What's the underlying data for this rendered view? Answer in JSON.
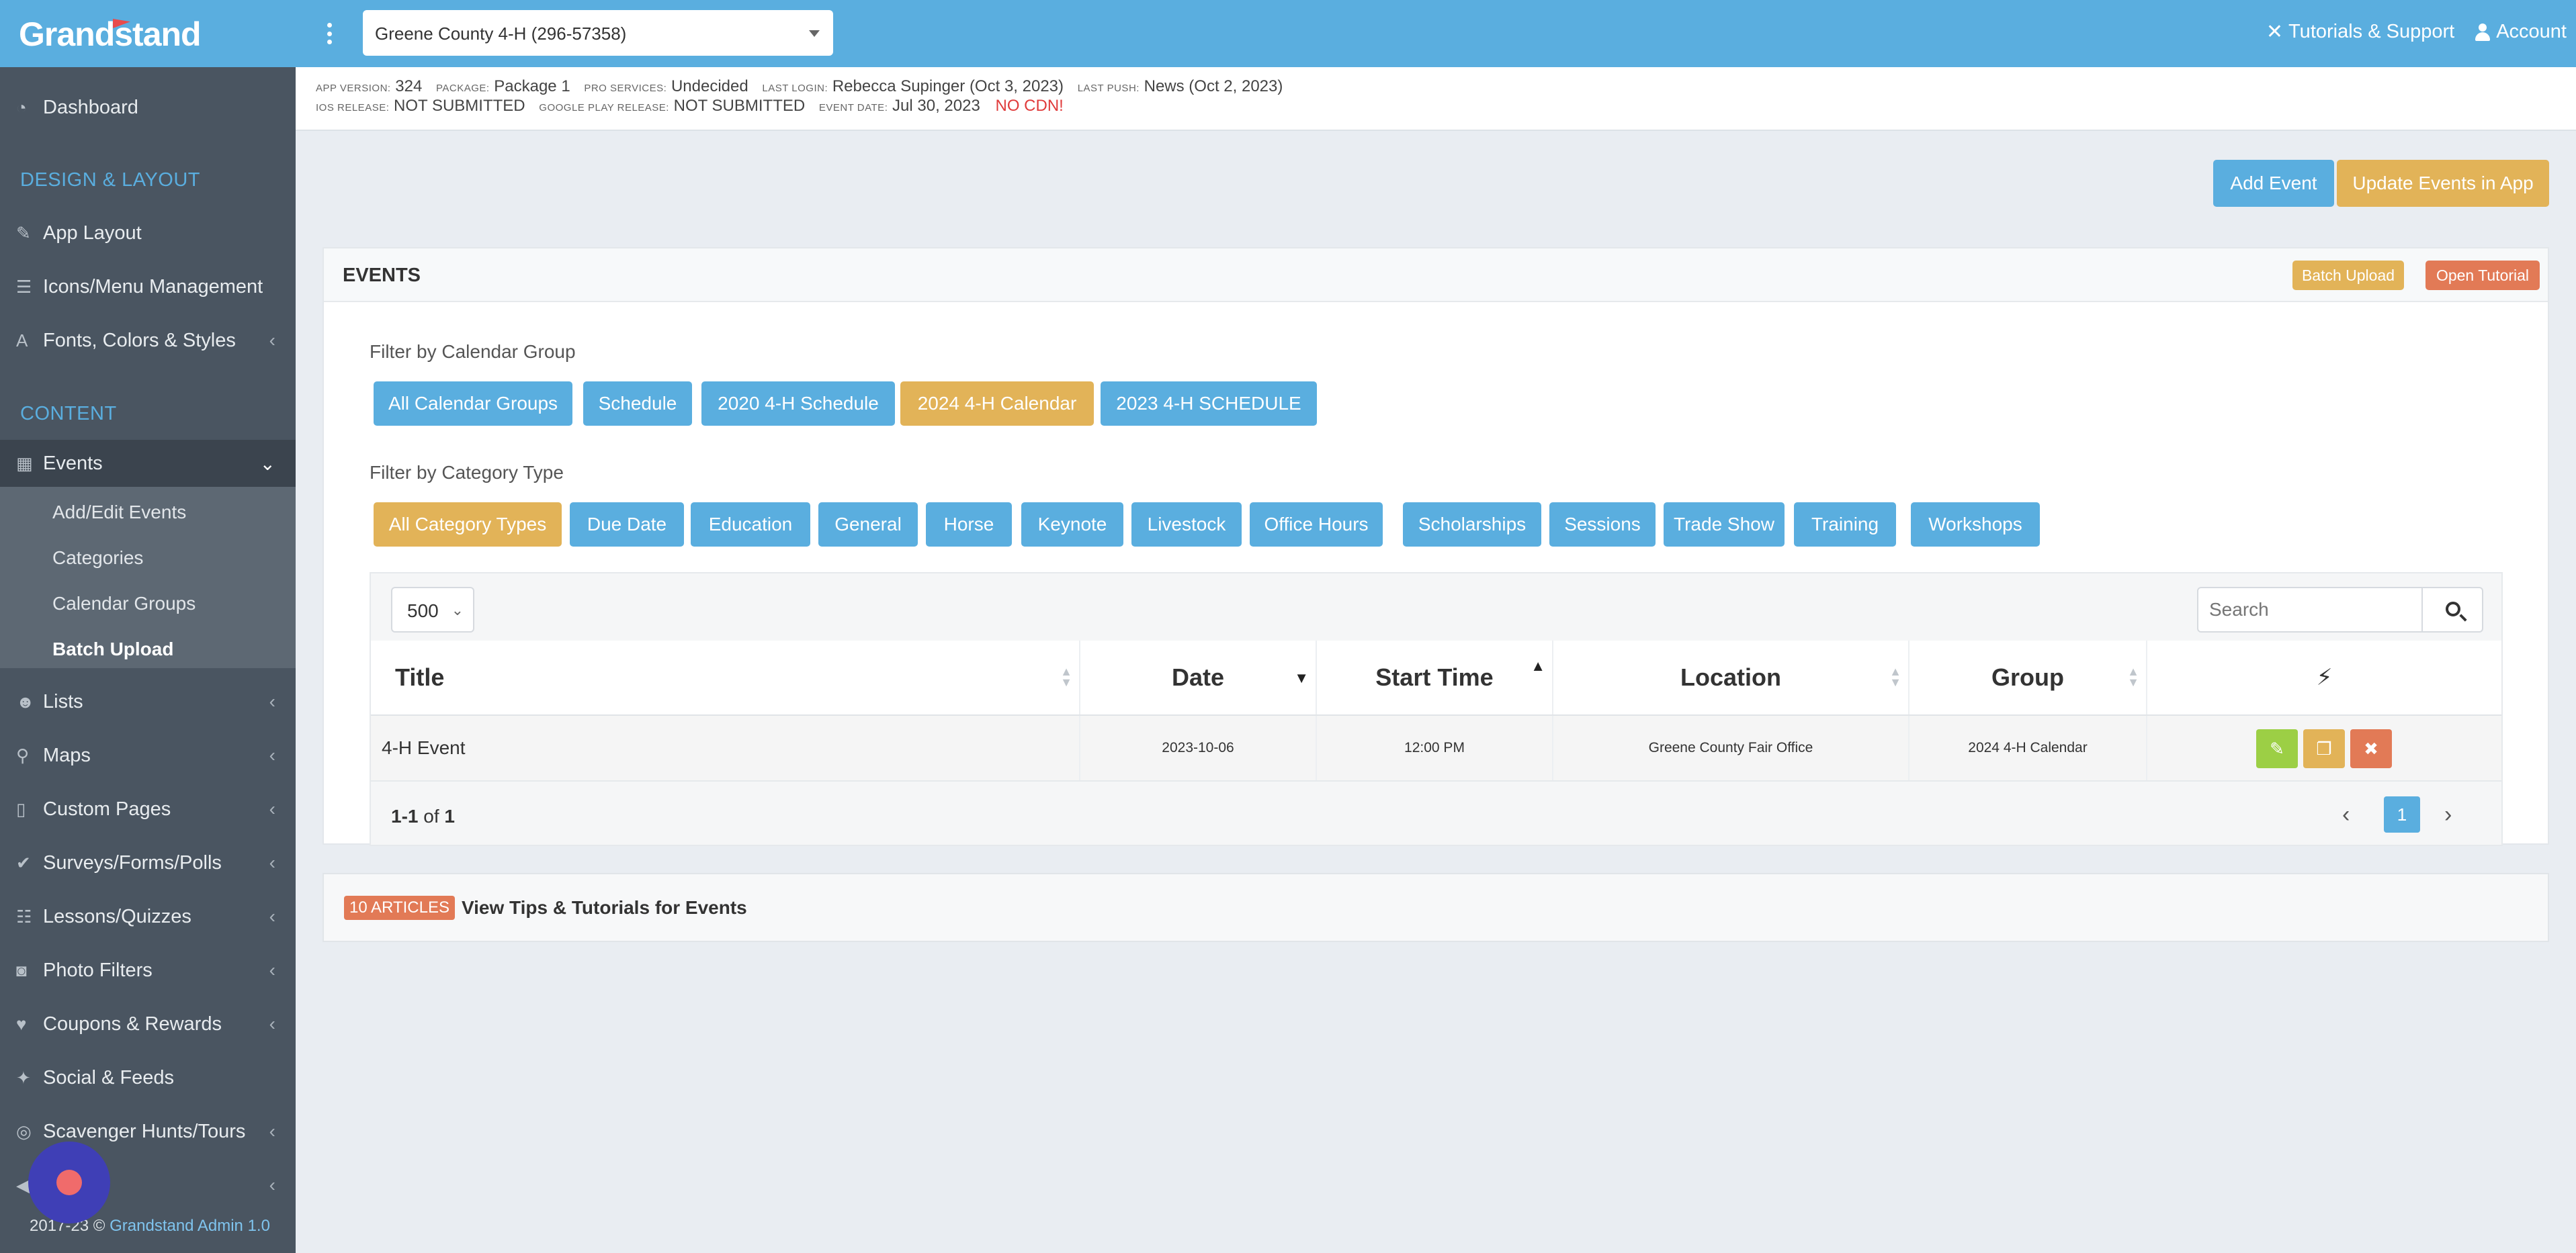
{
  "header": {
    "logo": "Grandstand",
    "app_selector": "Greene County 4-H (296-57358)",
    "tutorials": "Tutorials & Support",
    "account": "Account"
  },
  "info": {
    "app_version_label": "App Version:",
    "app_version": "324",
    "package_label": "Package:",
    "package": "Package 1",
    "pro_label": "Pro Services:",
    "pro": "Undecided",
    "last_login_label": "Last Login:",
    "last_login": "Rebecca Supinger (Oct 3, 2023)",
    "last_push_label": "Last Push:",
    "last_push": "News (Oct 2, 2023)",
    "ios_label": "iOS Release:",
    "ios": "NOT SUBMITTED",
    "gplay_label": "Google Play Release:",
    "gplay": "NOT SUBMITTED",
    "event_date_label": "Event Date:",
    "event_date": "Jul 30, 2023",
    "no_cdn": "NO CDN!"
  },
  "sidebar": {
    "dashboard": "Dashboard",
    "design_head": "DESIGN & LAYOUT",
    "app_layout": "App Layout",
    "icons_menu": "Icons/Menu Management",
    "fonts": "Fonts, Colors & Styles",
    "content_head": "CONTENT",
    "events": "Events",
    "sub": [
      "Add/Edit Events",
      "Categories",
      "Calendar Groups",
      "Batch Upload"
    ],
    "lists": "Lists",
    "maps": "Maps",
    "custom_pages": "Custom Pages",
    "surveys": "Surveys/Forms/Polls",
    "lessons": "Lessons/Quizzes",
    "photo_filters": "Photo Filters",
    "coupons": "Coupons & Rewards",
    "social": "Social & Feeds",
    "scavenger": "Scavenger Hunts/Tours",
    "footer_prefix": "2017-23 © ",
    "footer_link": "Grandstand Admin 1.0"
  },
  "actions": {
    "add_event": "Add Event",
    "update_events": "Update Events in App",
    "batch_upload": "Batch Upload",
    "open_tutorial": "Open Tutorial"
  },
  "panel": {
    "title": "EVENTS",
    "filter_group_label": "Filter by Calendar Group",
    "calendar_groups": [
      "All Calendar Groups",
      "Schedule",
      "2020 4-H Schedule",
      "2024 4-H Calendar",
      "2023 4-H SCHEDULE"
    ],
    "filter_category_label": "Filter by Category Type",
    "categories": [
      "All Category Types",
      "Due Date",
      "Education",
      "General",
      "Horse",
      "Keynote",
      "Livestock",
      "Office Hours",
      "Scholarships",
      "Sessions",
      "Trade Show",
      "Training",
      "Workshops"
    ]
  },
  "table": {
    "page_length": "500",
    "search_placeholder": "Search",
    "columns": [
      "Title",
      "Date",
      "Start Time",
      "Location",
      "Group"
    ],
    "rows": [
      {
        "title": "4-H Event",
        "date": "2023-10-06",
        "start": "12:00 PM",
        "location": "Greene County Fair Office",
        "group": "2024 4-H Calendar"
      }
    ],
    "info_range": "1-1",
    "info_of": " of ",
    "info_total": "1",
    "page": "1"
  },
  "tips": {
    "badge": "10 ARTICLES",
    "text": "View Tips & Tutorials for Events"
  },
  "colors": {
    "brand_blue": "#5aaedf",
    "gold": "#e2b358",
    "orange": "#e27a56",
    "sidebar": "#4a5561"
  }
}
